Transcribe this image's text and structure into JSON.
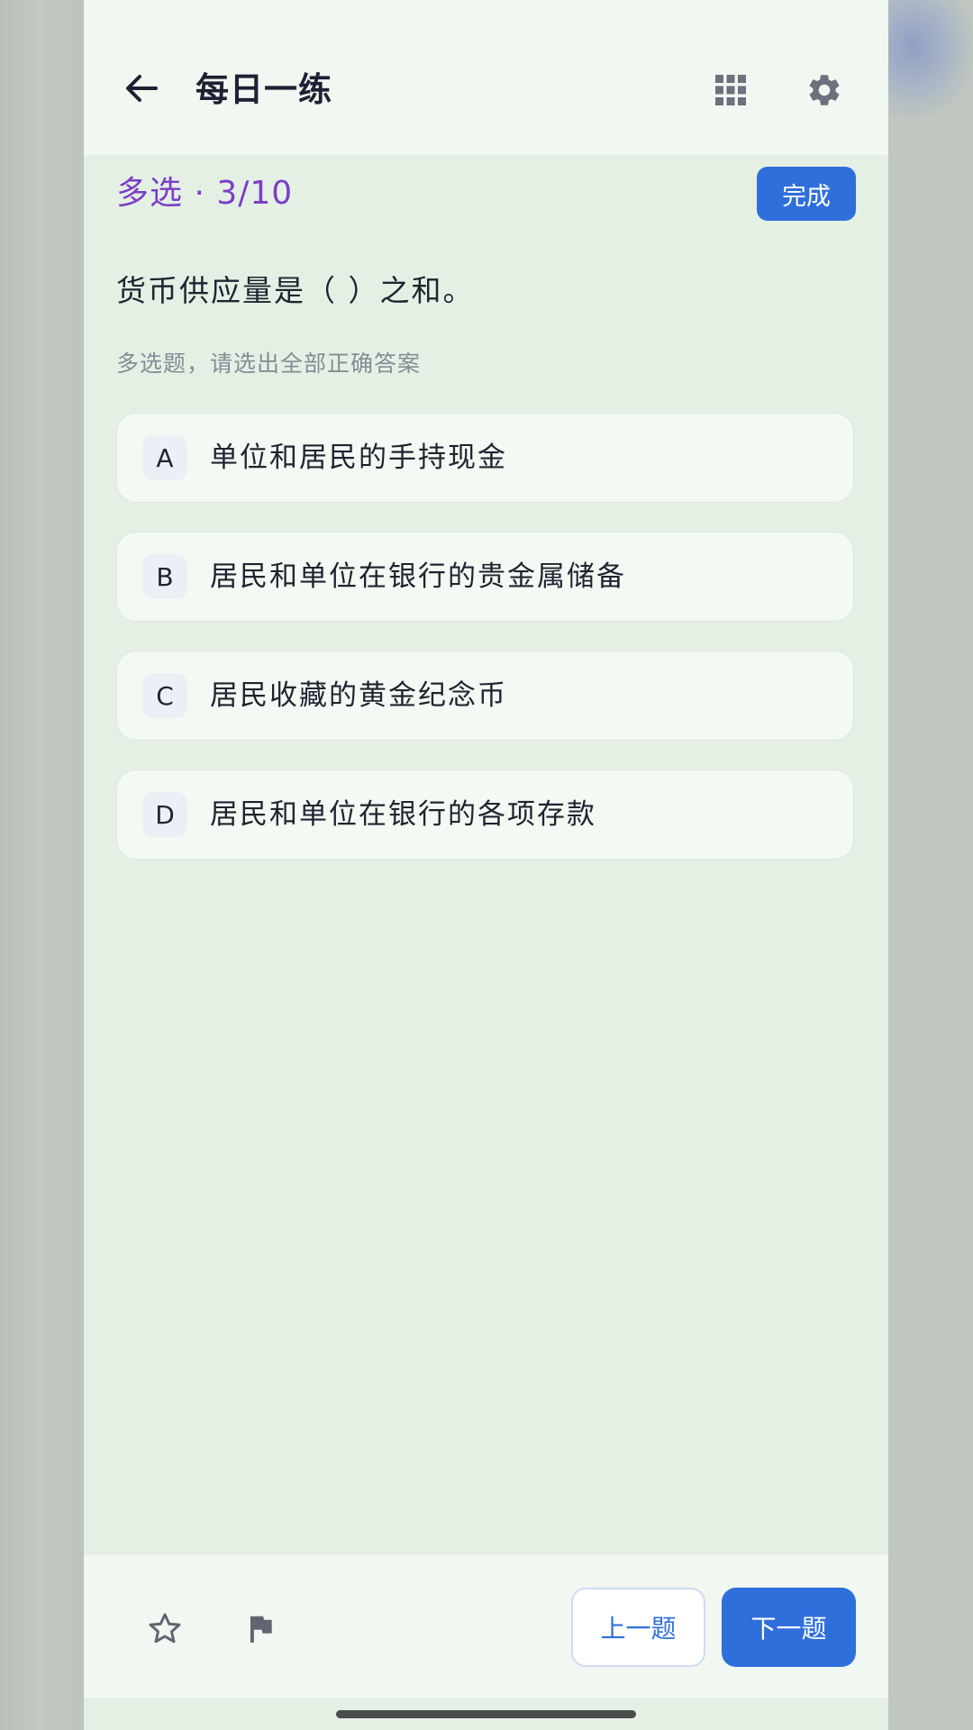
{
  "header": {
    "title": "每日一练",
    "icons": {
      "back": "arrow-left-icon",
      "grid": "grid-icon",
      "settings": "gear-icon"
    }
  },
  "question": {
    "type_label": "多选 · 3/10",
    "done_label": "完成",
    "text": "货币供应量是（ ）之和。",
    "hint": "多选题，请选出全部正确答案",
    "options": [
      {
        "letter": "A",
        "text": "单位和居民的手持现金"
      },
      {
        "letter": "B",
        "text": "居民和单位在银行的贵金属储备"
      },
      {
        "letter": "C",
        "text": "居民收藏的黄金纪念币"
      },
      {
        "letter": "D",
        "text": "居民和单位在银行的各项存款"
      }
    ]
  },
  "footer": {
    "icons": {
      "favorite": "star-icon",
      "report": "flag-icon"
    },
    "prev_label": "上一题",
    "next_label": "下一题"
  },
  "colors": {
    "accent": "#2f6fdc",
    "type_label": "#7b3fc6",
    "page_bg": "#e5f0e5",
    "bar_bg": "#f1f8f1"
  }
}
